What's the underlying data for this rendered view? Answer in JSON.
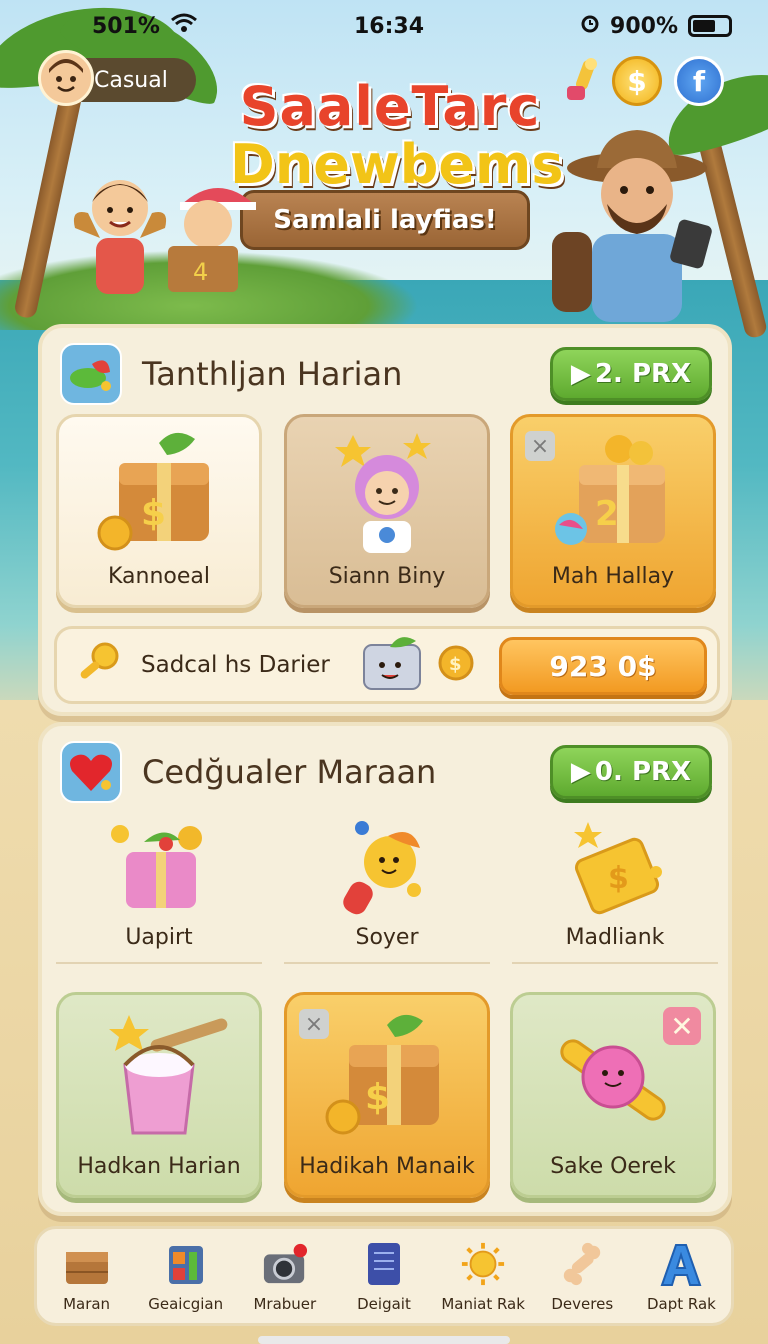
{
  "status_bar": {
    "signal": "501%",
    "time": "16:34",
    "battery": "900%"
  },
  "profile": {
    "name": "Casual"
  },
  "logo": {
    "line1": "SaaleTarc",
    "line2": "Dnewbems",
    "banner": "Samlali layfias!"
  },
  "panel1": {
    "title": "Tanthljan Harian",
    "button": "2. PRX",
    "cards": [
      {
        "label": "Kannoeal"
      },
      {
        "label": "Siann Biny"
      },
      {
        "label": "Mah Hallay"
      }
    ],
    "shop_row": {
      "label": "Sadcal hs Darier",
      "price": "923 0$"
    }
  },
  "panel2": {
    "title": "Cedğualer Maraan",
    "button": "0. PRX",
    "items": [
      {
        "label": "Uapirt"
      },
      {
        "label": "Soyer"
      },
      {
        "label": "Madliank"
      }
    ],
    "cards": [
      {
        "label": "Hadkan Harian"
      },
      {
        "label": "Hadikah Manaik"
      },
      {
        "label": "Sake Oerek"
      }
    ]
  },
  "nav": [
    {
      "label": "Maran",
      "icon": "crate-icon"
    },
    {
      "label": "Geaicgian",
      "icon": "tools-icon"
    },
    {
      "label": "Mrabuer",
      "icon": "camera-icon"
    },
    {
      "label": "Deigait",
      "icon": "book-icon"
    },
    {
      "label": "Maniat Rak",
      "icon": "sun-icon"
    },
    {
      "label": "Deveres",
      "icon": "bone-icon"
    },
    {
      "label": "Dapt Rak",
      "icon": "letter-a-icon"
    }
  ]
}
